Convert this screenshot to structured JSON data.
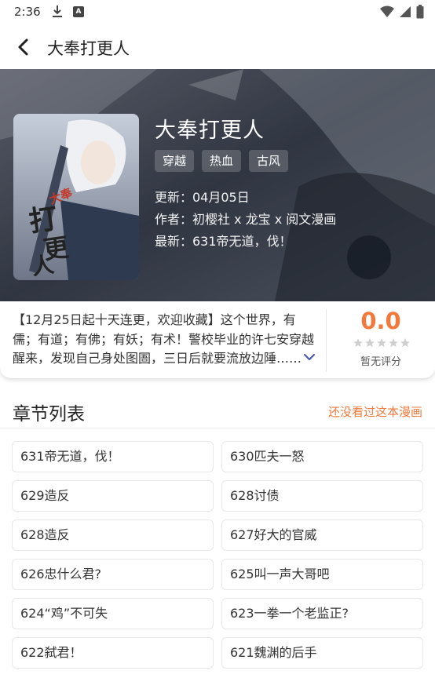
{
  "status": {
    "time": "2:36"
  },
  "toolbar": {
    "title": "大奉打更人"
  },
  "comic": {
    "title": "大奉打更人",
    "tags": [
      "穿越",
      "热血",
      "古风"
    ],
    "update": "更新：04月05日",
    "author": "作者：初樱社 x 龙宝 x 阅文漫画",
    "latest": "最新：631帝无道，伐！",
    "cover_text_a": "大奉",
    "cover_text_b": "打更人"
  },
  "summary": {
    "description": "【12月25日起十天连更，欢迎收藏】这个世界，有儒；有道；有佛；有妖；有术！警校毕业的许七安穿越醒来，发现自己身处图圄，三日后就要流放边陲……",
    "score": "0.0",
    "score_note": "暂无评分",
    "stars": 5
  },
  "chapters": {
    "title": "章节列表",
    "link": "还没看过这本漫画",
    "items": [
      "631帝无道，伐！",
      "630匹夫一怒",
      "629造反",
      "628讨债",
      "628造反",
      "627好大的官威",
      "626忠什么君?",
      "625叫一声大哥吧",
      "624“鸡”不可失",
      "623一拳一个老监正?",
      "622弑君！",
      "621魏渊的后手"
    ]
  },
  "colors": {
    "accent": "#f2793b",
    "hero_bg": "#3e4654"
  }
}
